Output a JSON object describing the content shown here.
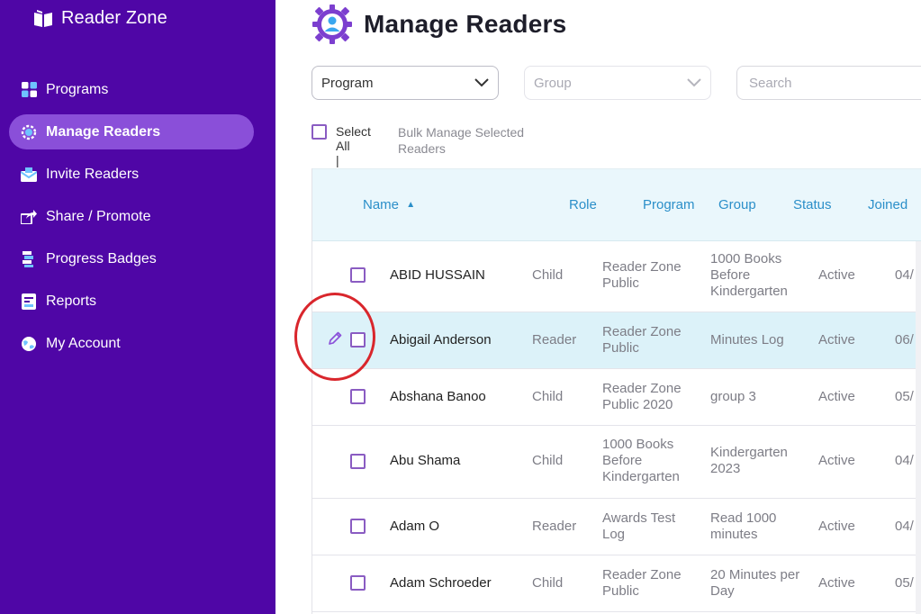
{
  "brand": {
    "title": "Reader Zone"
  },
  "sidebar": {
    "items": [
      {
        "label": "Programs",
        "icon": "grid-icon",
        "active": false
      },
      {
        "label": "Manage Readers",
        "icon": "gear-user-icon",
        "active": true
      },
      {
        "label": "Invite Readers",
        "icon": "envelope-icon",
        "active": false
      },
      {
        "label": "Share / Promote",
        "icon": "share-icon",
        "active": false
      },
      {
        "label": "Progress Badges",
        "icon": "badge-icon",
        "active": false
      },
      {
        "label": "Reports",
        "icon": "report-icon",
        "active": false
      },
      {
        "label": "My Account",
        "icon": "globe-icon",
        "active": false
      }
    ]
  },
  "page": {
    "title": "Manage Readers"
  },
  "filters": {
    "program": "Program",
    "group": "Group",
    "search_placeholder": "Search"
  },
  "bulk": {
    "select_all": "Select All",
    "select_all_cursor": "|",
    "bulk_manage": "Bulk Manage Selected Readers"
  },
  "table": {
    "columns": {
      "name": "Name",
      "sort_glyph": "▲",
      "role": "Role",
      "program": "Program",
      "group": "Group",
      "status": "Status",
      "joined": "Joined"
    },
    "rows": [
      {
        "name": "ABID HUSSAIN",
        "role": "Child",
        "program": "Reader Zone Public",
        "group": "1000 Books Before Kindergarten",
        "status": "Active",
        "joined": "04/"
      },
      {
        "name": "Abigail Anderson",
        "role": "Reader",
        "program": "Reader Zone Public",
        "group": "Minutes Log",
        "status": "Active",
        "joined": "06/"
      },
      {
        "name": "Abshana Banoo",
        "role": "Child",
        "program": "Reader Zone Public 2020",
        "group": "group 3",
        "status": "Active",
        "joined": "05/"
      },
      {
        "name": "Abu Shama",
        "role": "Child",
        "program": "1000 Books Before Kindergarten",
        "group": "Kindergarten 2023",
        "status": "Active",
        "joined": "04/"
      },
      {
        "name": "Adam O",
        "role": "Reader",
        "program": "Awards Test Log",
        "group": "Read 1000 minutes",
        "status": "Active",
        "joined": "04/"
      },
      {
        "name": "Adam Schroeder",
        "role": "Child",
        "program": "Reader Zone Public",
        "group": "20 Minutes per Day",
        "status": "Active",
        "joined": "05/"
      }
    ]
  },
  "colors": {
    "sidebar_bg": "#4f06a6",
    "active_item": "#8a4fd9",
    "header_text": "#2b8fc9",
    "highlight_row": "#dcf2f9",
    "annotation": "#d9262c"
  }
}
